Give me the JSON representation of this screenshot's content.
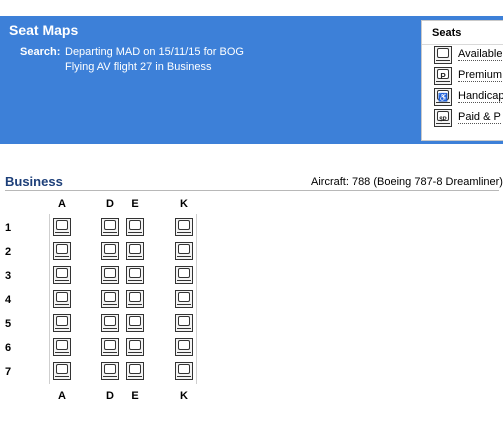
{
  "header": {
    "title": "Seat Maps",
    "search_label": "Search:",
    "search_line1": "Departing MAD on 15/11/15 for BOG",
    "search_line2": "Flying AV flight 27 in Business"
  },
  "legend": {
    "title": "Seats",
    "items": [
      {
        "label": "Available",
        "icon": "seat-available-icon"
      },
      {
        "label": "Premium",
        "icon": "seat-premium-icon",
        "glyph": "P"
      },
      {
        "label": "Handicap",
        "icon": "seat-handicap-icon",
        "glyph": "♿"
      },
      {
        "label": "Paid & P",
        "icon": "seat-paid-icon",
        "glyph": "$P"
      }
    ]
  },
  "cabin": {
    "name": "Business",
    "aircraft": "Aircraft: 788 (Boeing 787-8 Dreamliner)",
    "columns": [
      "A",
      "D",
      "E",
      "K"
    ],
    "rows": [
      "1",
      "2",
      "3",
      "4",
      "5",
      "6",
      "7"
    ]
  },
  "colors": {
    "header_bg": "#3d80d8",
    "cabin_title": "#1d3f79"
  }
}
